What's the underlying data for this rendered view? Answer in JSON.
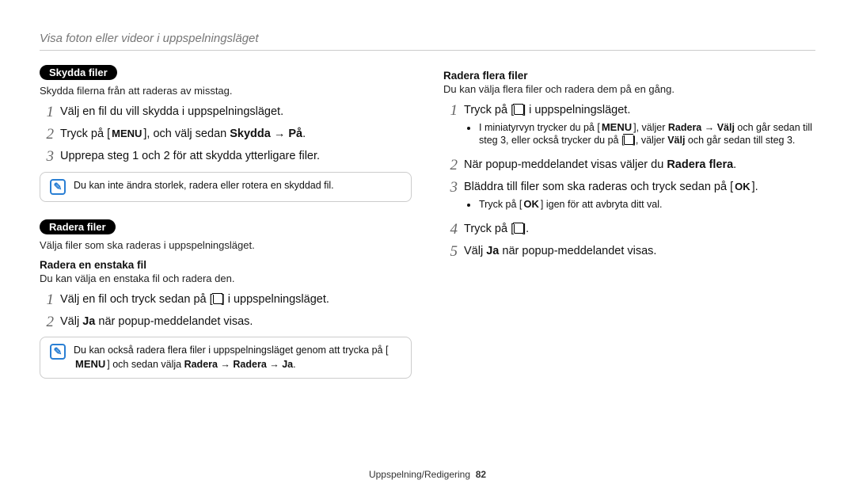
{
  "header": "Visa foton eller videor i uppspelningsläget",
  "left": {
    "protect": {
      "pill": "Skydda filer",
      "desc": "Skydda filerna från att raderas av misstag.",
      "steps": {
        "1": "Välj en fil du vill skydda i uppspelningsläget.",
        "2a": "Tryck på [",
        "2menu": "MENU",
        "2b": "], och välj sedan ",
        "2strong": "Skydda → På",
        "2c": ".",
        "3": "Upprepa steg 1 och 2 för att skydda ytterligare filer."
      },
      "callout": "Du kan inte ändra storlek, radera eller rotera en skyddad fil."
    },
    "delete": {
      "pill": "Radera filer",
      "desc": "Välja filer som ska raderas i uppspelningsläget.",
      "sub1": "Radera en enstaka fil",
      "sub1desc": "Du kan välja en enstaka fil och radera den.",
      "steps": {
        "1a": "Välj en fil och tryck sedan på [",
        "1b": "] i uppspelningsläget.",
        "2a": "Välj ",
        "2strong": "Ja",
        "2b": " när popup-meddelandet visas."
      },
      "callout2a": "Du kan också radera flera filer i uppspelningsläget genom att trycka på [",
      "callout2menu": "MENU",
      "callout2b": "] och sedan välja ",
      "callout2strong": "Radera → Radera → Ja",
      "callout2c": "."
    }
  },
  "right": {
    "sub": "Radera flera filer",
    "desc": "Du kan välja flera filer och radera dem på en gång.",
    "steps": {
      "1a": "Tryck på [",
      "1b": "] i uppspelningsläget.",
      "b1a": "I miniatyrvyn trycker du på [",
      "b1menu": "MENU",
      "b1b": "], väljer ",
      "b1strong": "Radera → Välj",
      "b1c": " och går sedan till steg 3, eller också trycker du på [",
      "b1d": "], väljer ",
      "b1strong2": "Välj",
      "b1e": " och går sedan till steg 3.",
      "2a": "När popup-meddelandet visas väljer du ",
      "2strong": "Radera flera",
      "2b": ".",
      "3a": "Bläddra till filer som ska raderas och tryck sedan på [",
      "3ok": "OK",
      "3b": "].",
      "b3a": "Tryck på [",
      "b3ok": "OK",
      "b3b": "] igen för att avbryta ditt val.",
      "4a": "Tryck på [",
      "4b": "].",
      "5a": "Välj ",
      "5strong": "Ja",
      "5b": " när popup-meddelandet visas."
    }
  },
  "footer": {
    "section": "Uppspelning/Redigering",
    "page": "82"
  }
}
